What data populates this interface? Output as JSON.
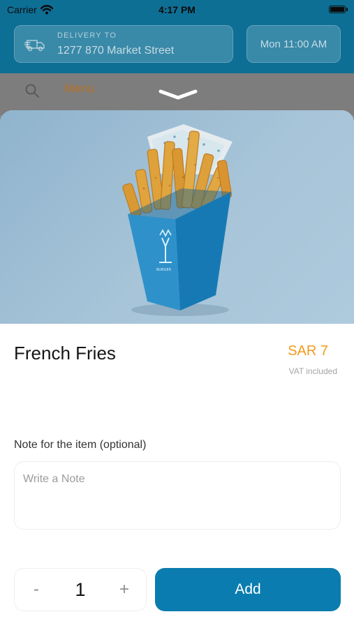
{
  "status_bar": {
    "carrier": "Carrier",
    "time": "4:17 PM"
  },
  "header": {
    "delivery_label": "DELIVERY TO",
    "delivery_address": "1277 870 Market Street",
    "delivery_time": "Mon 11:00 AM"
  },
  "menu_bar": {
    "menu_label": "Menu"
  },
  "item": {
    "name": "French Fries",
    "price": "SAR 7",
    "vat_text": "VAT included"
  },
  "note": {
    "label": "Note for the item (optional)",
    "placeholder": "Write a Note",
    "value": ""
  },
  "quantity": {
    "minus_label": "-",
    "value": "1",
    "plus_label": "+"
  },
  "actions": {
    "add_label": "Add"
  },
  "icons": {
    "wifi": "wifi-icon",
    "battery": "battery-icon",
    "truck": "delivery-truck-icon",
    "search": "search-icon",
    "collapse": "chevron-down-icon"
  },
  "colors": {
    "header": "#0e6f95",
    "accent_price": "#f39a1d",
    "menu_text": "#b76f22",
    "add_button": "#0a7caf",
    "image_background": "#a7c4d8"
  }
}
